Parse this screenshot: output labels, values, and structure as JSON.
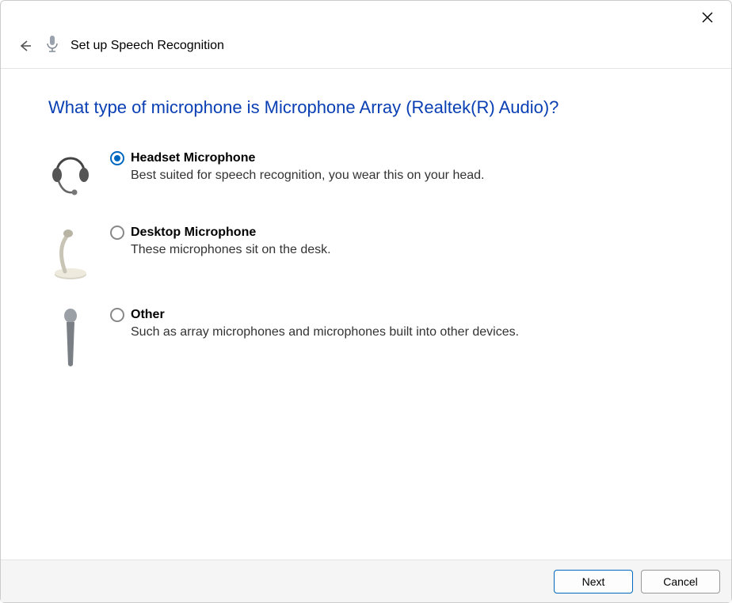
{
  "header": {
    "title": "Set up Speech Recognition"
  },
  "main": {
    "heading": "What type of microphone is Microphone Array (Realtek(R) Audio)?",
    "options": [
      {
        "label": "Headset Microphone",
        "desc": "Best suited for speech recognition, you wear this on your head.",
        "selected": true
      },
      {
        "label": "Desktop Microphone",
        "desc": "These microphones sit on the desk.",
        "selected": false
      },
      {
        "label": "Other",
        "desc": "Such as array microphones and microphones built into other devices.",
        "selected": false
      }
    ]
  },
  "footer": {
    "next": "Next",
    "cancel": "Cancel"
  }
}
